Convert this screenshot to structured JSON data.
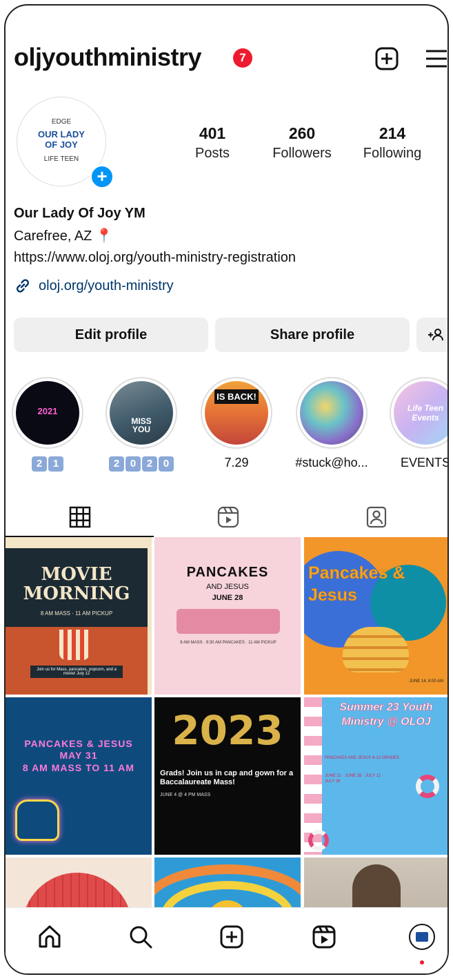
{
  "profile": {
    "username": "oljyouthministry",
    "notifications": "7",
    "stats": [
      {
        "value": "401",
        "label": "Posts"
      },
      {
        "value": "260",
        "label": "Followers"
      },
      {
        "value": "214",
        "label": "Following"
      }
    ],
    "avatar": {
      "line1": "EDGE",
      "line2": "OUR LADY",
      "line3": "OF JOY",
      "line4": "LIFE TEEN"
    },
    "display_name": "Our Lady Of Joy YM",
    "location": "Carefree, AZ 📍",
    "website_text": "https://www.oloj.org/youth-ministry-registration",
    "link": "oloj.org/youth-ministry"
  },
  "buttons": {
    "edit": "Edit profile",
    "share": "Share profile"
  },
  "highlights": [
    {
      "caption_boxes": [
        "2",
        "1"
      ],
      "thumb_text": "2021"
    },
    {
      "caption_boxes": [
        "2",
        "0",
        "2",
        "0"
      ],
      "thumb_text": "MISS YOU"
    },
    {
      "caption": "7.29",
      "thumb_text": "IS BACK!"
    },
    {
      "caption": "#stuck@ho..."
    },
    {
      "caption": "EVENTS",
      "thumb_text": "Life Teen Events"
    }
  ],
  "posts": [
    {
      "title": "MOVIE MORNING",
      "sub": "8 AM MASS · 11 AM PICKUP",
      "foot": "Join us for Mass, pancakes, popcorn, and a movie! July 12"
    },
    {
      "title": "PANCAKES",
      "sub": "AND JESUS",
      "date": "JUNE 28",
      "foot": "8 AM MASS · 9:30 AM PANCAKES · 11 AM PICKUP"
    },
    {
      "title": "Pancakes & Jesus",
      "foot": "JUNE 14, 8:00 AM"
    },
    {
      "title": "PANCAKES & JESUS",
      "sub": "MAY 31",
      "date": "8 AM MASS TO 11 AM"
    },
    {
      "title": "2023",
      "sub": "Grads! Join us in cap and gown for a Baccalaureate Mass!",
      "foot": "JUNE 4 @ 4 PM MASS"
    },
    {
      "title": "Summer 23 Youth Ministry @ OLOJ",
      "sub": "PANCAKES AND JESUS 6-12 GRADES",
      "foot": "JUNE 21 · JUNE 28 · JULY 12 · JULY 26"
    },
    {
      "title": ""
    },
    {
      "title": ""
    },
    {
      "title": ""
    }
  ],
  "colors": {
    "accent": "#0095f6",
    "badge": "#ed1b2f",
    "link": "#00376b",
    "button_bg": "#efefef"
  }
}
